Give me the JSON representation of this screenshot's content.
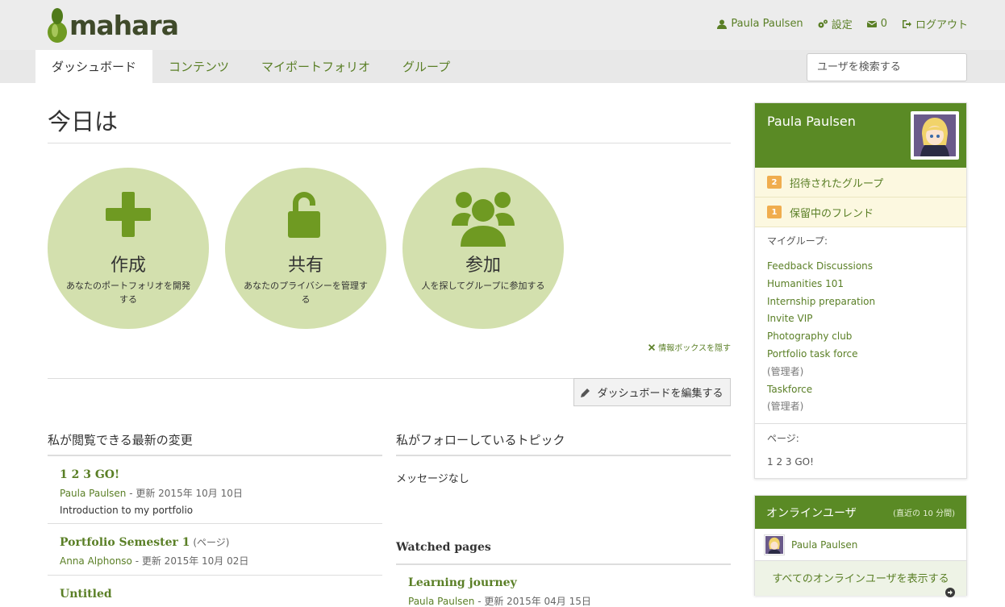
{
  "app": {
    "logo_text": "mahara"
  },
  "user_nav": {
    "user_name": "Paula Paulsen",
    "settings": "設定",
    "messages_count": "0",
    "logout": "ログアウト"
  },
  "main_nav": {
    "tabs": [
      {
        "label": "ダッシュボード",
        "active": true
      },
      {
        "label": "コンテンツ"
      },
      {
        "label": "マイポートフォリオ"
      },
      {
        "label": "グループ"
      }
    ]
  },
  "search": {
    "placeholder": "ユーザを検索する"
  },
  "page": {
    "title": "今日は",
    "circles": [
      {
        "title": "作成",
        "desc": "あなたのポートフォリオを開発する",
        "icon": "plus-icon"
      },
      {
        "title": "共有",
        "desc": "あなたのプライバシーを管理する",
        "icon": "unlock-icon"
      },
      {
        "title": "参加",
        "desc": "人を探してグループに参加する",
        "icon": "users-icon"
      }
    ],
    "hide_info": "情報ボックスを隠す",
    "edit_dashboard": "ダッシュボードを編集する"
  },
  "latest_changes": {
    "heading": "私が閲覧できる最新の変更",
    "entries": [
      {
        "title": "1 2 3 GO!",
        "type": "",
        "author": "Paula Paulsen",
        "updated": " - 更新 2015年 10月 10日",
        "desc": "Introduction to my portfolio"
      },
      {
        "title": "Portfolio Semester 1",
        "type": " (ページ)",
        "author": "Anna Alphonso",
        "updated": " - 更新 2015年 10月 02日",
        "desc": ""
      },
      {
        "title": "Untitled",
        "type": "",
        "author": "",
        "updated": "",
        "desc": ""
      }
    ]
  },
  "followed_topics": {
    "heading": "私がフォローしているトピック",
    "empty": "メッセージなし"
  },
  "watched_pages": {
    "heading": "Watched pages",
    "entries": [
      {
        "title": "Learning journey",
        "author": "Paula Paulsen",
        "updated": " - 更新 2015年 04月 15日"
      }
    ]
  },
  "profile": {
    "name": "Paula Paulsen",
    "notices": [
      {
        "count": "2",
        "label": "招待されたグループ"
      },
      {
        "count": "1",
        "label": "保留中のフレンド"
      }
    ],
    "groups_label": "マイグループ:",
    "groups": [
      {
        "name": "Feedback Discussions",
        "role": ""
      },
      {
        "name": "Humanities 101",
        "role": ""
      },
      {
        "name": "Internship preparation",
        "role": ""
      },
      {
        "name": "Invite VIP",
        "role": ""
      },
      {
        "name": "Photography club",
        "role": ""
      },
      {
        "name": "Portfolio task force",
        "role": "(管理者)"
      },
      {
        "name": "Taskforce",
        "role": "(管理者)"
      }
    ],
    "pages_label": "ページ:",
    "pages": [
      "1 2 3 GO!"
    ]
  },
  "online_users": {
    "heading": "オンラインユーザ",
    "subheading": "(直近の 10 分間)",
    "users": [
      "Paula Paulsen"
    ],
    "show_all": "すべてのオンラインユーザを表示する"
  },
  "colors": {
    "accent": "#5a8a25",
    "link": "#5a7f26",
    "circle": "#d3e0ae",
    "badge": "#f0ad4e"
  }
}
